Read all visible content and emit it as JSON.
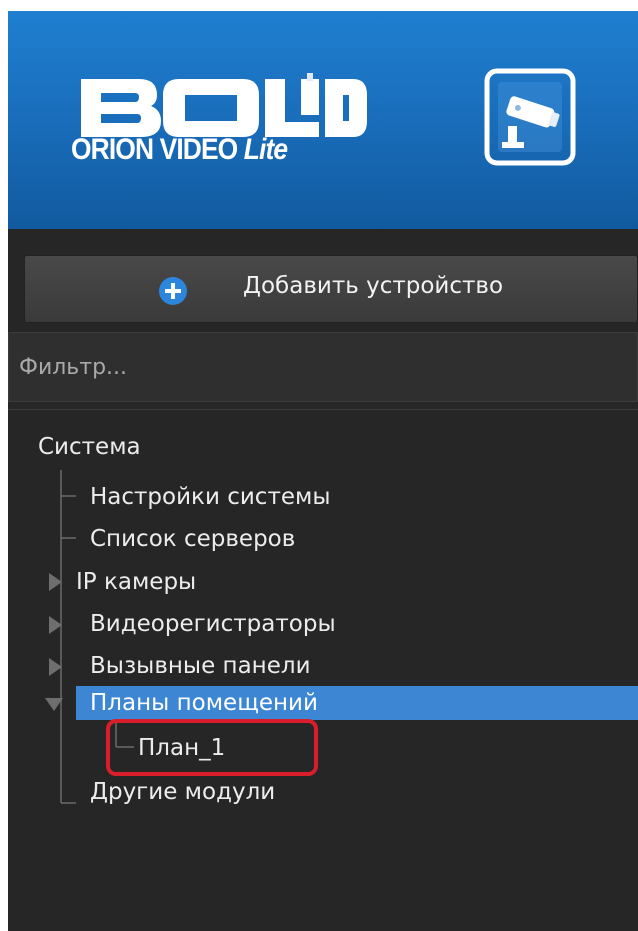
{
  "app": {
    "brand_logo_text": "BOLID",
    "product_name": "ORION VIDEO",
    "product_edition": "Lite"
  },
  "toolbar": {
    "add_device_label": "Добавить устройство"
  },
  "filter": {
    "placeholder": "Фильтр..."
  },
  "tree": {
    "root": "Система",
    "items": [
      {
        "label": "Настройки системы",
        "state": "leaf"
      },
      {
        "label": "Список серверов",
        "state": "leaf"
      },
      {
        "label": "IP камеры",
        "state": "collapsed"
      },
      {
        "label": "Видеорегистраторы",
        "state": "collapsed"
      },
      {
        "label": "Вызывные панели",
        "state": "collapsed"
      },
      {
        "label": "Планы помещений",
        "state": "expanded",
        "selected": true,
        "children": [
          {
            "label": "План_1",
            "highlighted": true
          }
        ]
      },
      {
        "label": "Другие модули",
        "state": "leaf"
      }
    ]
  },
  "colors": {
    "header_blue": "#1a6fbd",
    "selection_blue": "#3d86d4",
    "highlight_red": "#d81e2a",
    "panel_dark": "#262626"
  },
  "icons": {
    "header_button": "security-camera-icon",
    "add_button": "plus-circle-icon"
  }
}
